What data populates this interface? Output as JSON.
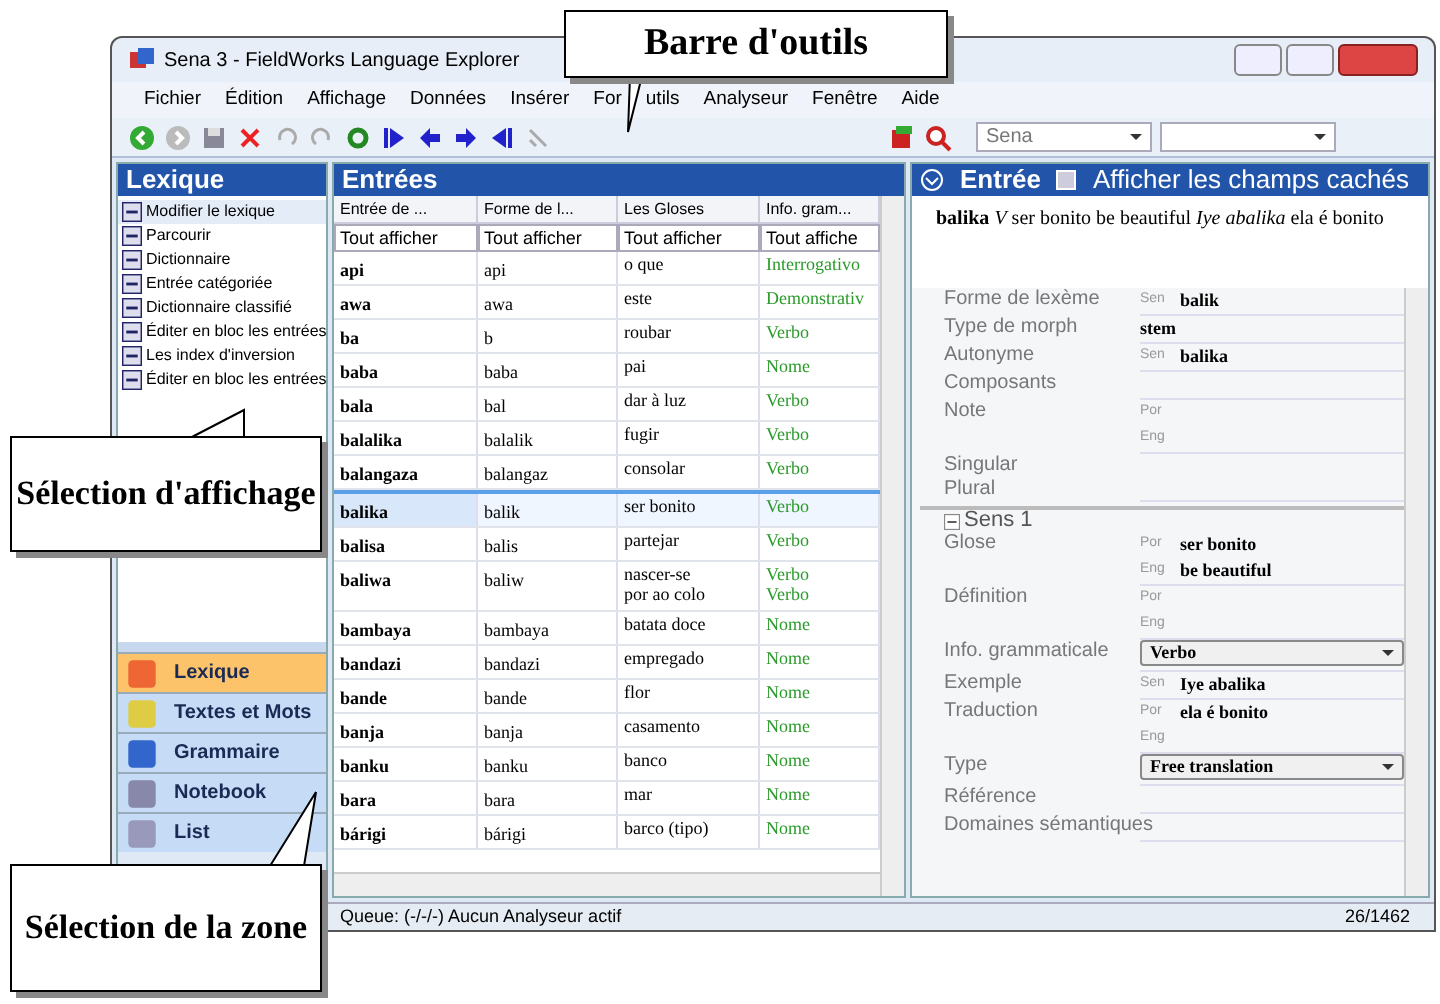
{
  "window": {
    "title": "Sena 3 - FieldWorks Language Explorer"
  },
  "menu": [
    "Fichier",
    "Édition",
    "Affichage",
    "Données",
    "Insérer",
    "For",
    "utils",
    "Analyseur",
    "Fenêtre",
    "Aide"
  ],
  "toolbar": {
    "language_combo": "Sena"
  },
  "sidebar": {
    "title": "Lexique",
    "items": [
      {
        "label": "Modifier le lexique",
        "selected": true
      },
      {
        "label": "Parcourir",
        "selected": false
      },
      {
        "label": "Dictionnaire",
        "selected": false
      },
      {
        "label": "Entrée catégoriée",
        "selected": false
      },
      {
        "label": "Dictionnaire classifié",
        "selected": false
      },
      {
        "label": "Éditer en bloc les entrées",
        "selected": false
      },
      {
        "label": "Les index d'inversion",
        "selected": false
      },
      {
        "label": "Éditer en bloc les entrées",
        "selected": false
      }
    ],
    "areas": [
      {
        "label": "Lexique",
        "selected": true
      },
      {
        "label": "Textes et Mots",
        "selected": false
      },
      {
        "label": "Grammaire",
        "selected": false
      },
      {
        "label": "Notebook",
        "selected": false
      },
      {
        "label": "List",
        "selected": false
      }
    ]
  },
  "entries": {
    "title": "Entrées",
    "columns": [
      "Entrée de ...",
      "Forme de l...",
      "Les Gloses",
      "Info. gram..."
    ],
    "filters": [
      "Tout afficher",
      "Tout afficher",
      "Tout afficher",
      "Tout affiche"
    ],
    "rows": [
      {
        "cells": [
          "api",
          "api",
          "o que",
          "Interrogativo"
        ],
        "selected": false
      },
      {
        "cells": [
          "awa",
          "awa",
          "este",
          "Demonstrativ"
        ],
        "selected": false
      },
      {
        "cells": [
          "ba",
          "b",
          "roubar",
          "Verbo"
        ],
        "selected": false
      },
      {
        "cells": [
          "baba",
          "baba",
          "pai",
          "Nome"
        ],
        "selected": false
      },
      {
        "cells": [
          "bala",
          "bal",
          "dar à luz",
          "Verbo"
        ],
        "selected": false
      },
      {
        "cells": [
          "balalika",
          "balalik",
          "fugir",
          "Verbo"
        ],
        "selected": false
      },
      {
        "cells": [
          "balangaza",
          "balangaz",
          "consolar",
          "Verbo"
        ],
        "selected": false
      },
      {
        "cells": [
          "balika",
          "balik",
          "ser bonito",
          "Verbo"
        ],
        "selected": true
      },
      {
        "cells": [
          "balisa",
          "balis",
          "partejar",
          "Verbo"
        ],
        "selected": false
      },
      {
        "cells": [
          "baliwa",
          "baliw",
          "nascer-se\npor ao colo",
          "Verbo\nVerbo"
        ],
        "selected": false
      },
      {
        "cells": [
          "bambaya",
          "bambaya",
          "batata doce",
          "Nome"
        ],
        "selected": false
      },
      {
        "cells": [
          "bandazi",
          "bandazi",
          "empregado",
          "Nome"
        ],
        "selected": false
      },
      {
        "cells": [
          "bande",
          "bande",
          "flor",
          "Nome"
        ],
        "selected": false
      },
      {
        "cells": [
          "banja",
          "banja",
          "casamento",
          "Nome"
        ],
        "selected": false
      },
      {
        "cells": [
          "banku",
          "banku",
          "banco",
          "Nome"
        ],
        "selected": false
      },
      {
        "cells": [
          "bara",
          "bara",
          "mar",
          "Nome"
        ],
        "selected": false
      },
      {
        "cells": [
          "bárigi",
          "bárigi",
          "barco (tipo)",
          "Nome"
        ],
        "selected": false
      }
    ]
  },
  "entry": {
    "title": "Entrée",
    "show_hidden": {
      "label": "Afficher les champs cachés",
      "checked": false
    },
    "summary": "**balika** *V* ser bonito be beautiful *Iye abalika* ela é bonito",
    "fields": [
      {
        "kind": "field",
        "label": "Forme de lexème",
        "values": [
          {
            "ws": "Sen",
            "text": "balik"
          }
        ]
      },
      {
        "kind": "field",
        "label": "Type de morph",
        "values": [
          {
            "text": "stem"
          }
        ]
      },
      {
        "kind": "field",
        "label": "Autonyme",
        "values": [
          {
            "ws": "Sen",
            "text": "balika"
          }
        ]
      },
      {
        "kind": "field",
        "label": "Composants"
      },
      {
        "kind": "field",
        "label": "Note",
        "values": [
          {
            "ws": "Por"
          },
          {
            "ws": "Eng"
          }
        ]
      },
      {
        "kind": "field",
        "label": "Singular\nPlural"
      },
      {
        "kind": "section",
        "label": "Sens 1"
      },
      {
        "kind": "field",
        "label": "Glose",
        "values": [
          {
            "ws": "Por",
            "text": "ser bonito"
          },
          {
            "ws": "Eng",
            "text": "be beautiful"
          }
        ]
      },
      {
        "kind": "field",
        "label": "Définition",
        "values": [
          {
            "ws": "Por"
          },
          {
            "ws": "Eng"
          }
        ]
      },
      {
        "kind": "combo",
        "label": "Info. grammaticale",
        "values": [
          {
            "text": "Verbo"
          }
        ]
      },
      {
        "kind": "field",
        "label": "Exemple",
        "values": [
          {
            "ws": "Sen",
            "text": "Iye abalika"
          }
        ]
      },
      {
        "kind": "field",
        "label": "Traduction",
        "values": [
          {
            "ws": "Por",
            "text": "ela é bonito"
          },
          {
            "ws": "Eng"
          }
        ]
      },
      {
        "kind": "combo",
        "label": "Type",
        "values": [
          {
            "text": "Free translation"
          }
        ]
      },
      {
        "kind": "field",
        "label": "Référence"
      },
      {
        "kind": "field",
        "label": "Domaines sémantiques"
      }
    ]
  },
  "status_bar": {
    "left": "Queue: (-/-/-) Aucun Analyseur actif",
    "right": "26/1462"
  },
  "callouts": [
    {
      "text": "Barre d'outils"
    },
    {
      "text": "Sélection d'affichage"
    },
    {
      "text": "Sélection de la zone"
    }
  ]
}
